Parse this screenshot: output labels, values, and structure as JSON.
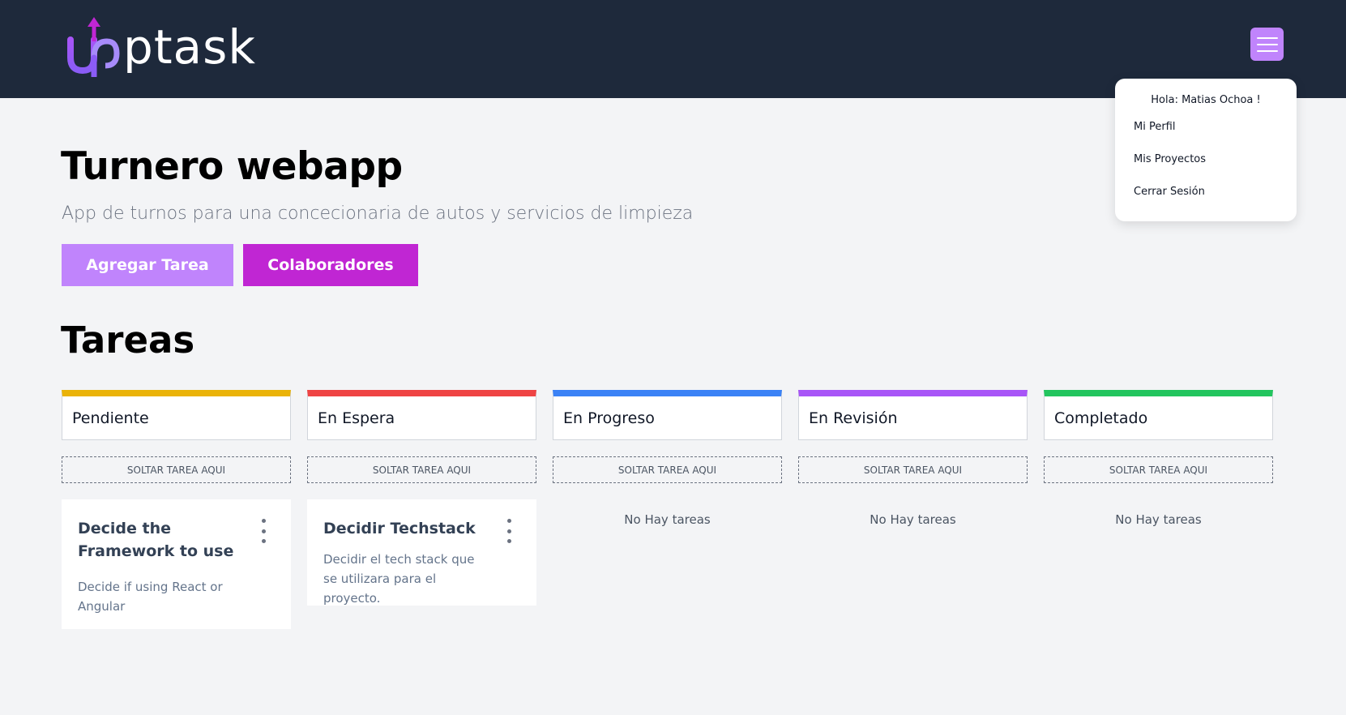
{
  "header": {
    "logo_text": "ptask",
    "logo_letter": "u",
    "menu_icon": "hamburger-icon",
    "colors": {
      "background": "#1e293b",
      "accent": "#c084fc"
    }
  },
  "user_menu": {
    "greeting": "Hola: Matias Ochoa !",
    "items": [
      {
        "label": "Mi Perfil"
      },
      {
        "label": "Mis Proyectos"
      },
      {
        "label": "Cerrar Sesión"
      }
    ]
  },
  "project": {
    "title": "Turnero webapp",
    "description": "App de turnos para una concecionaria de autos y servicios de limpieza",
    "add_task_label": "Agregar Tarea",
    "collaborators_label": "Colaboradores"
  },
  "tasks_section": {
    "heading": "Tareas",
    "drop_label": "SOLTAR TAREA AQUI",
    "empty_label": "No Hay tareas",
    "columns": [
      {
        "title": "Pendiente",
        "color": "#eab308",
        "tasks": [
          {
            "name": "Decide the Framework to use",
            "description": "Decide if using React or Angular"
          }
        ]
      },
      {
        "title": "En Espera",
        "color": "#ef4444",
        "tasks": [
          {
            "name": "Decidir Techstack",
            "description": "Decidir el tech stack que se utilizara para el proyecto."
          }
        ]
      },
      {
        "title": "En Progreso",
        "color": "#3b82f6",
        "tasks": []
      },
      {
        "title": "En Revisión",
        "color": "#a855f7",
        "tasks": []
      },
      {
        "title": "Completado",
        "color": "#22c55e",
        "tasks": []
      }
    ]
  }
}
